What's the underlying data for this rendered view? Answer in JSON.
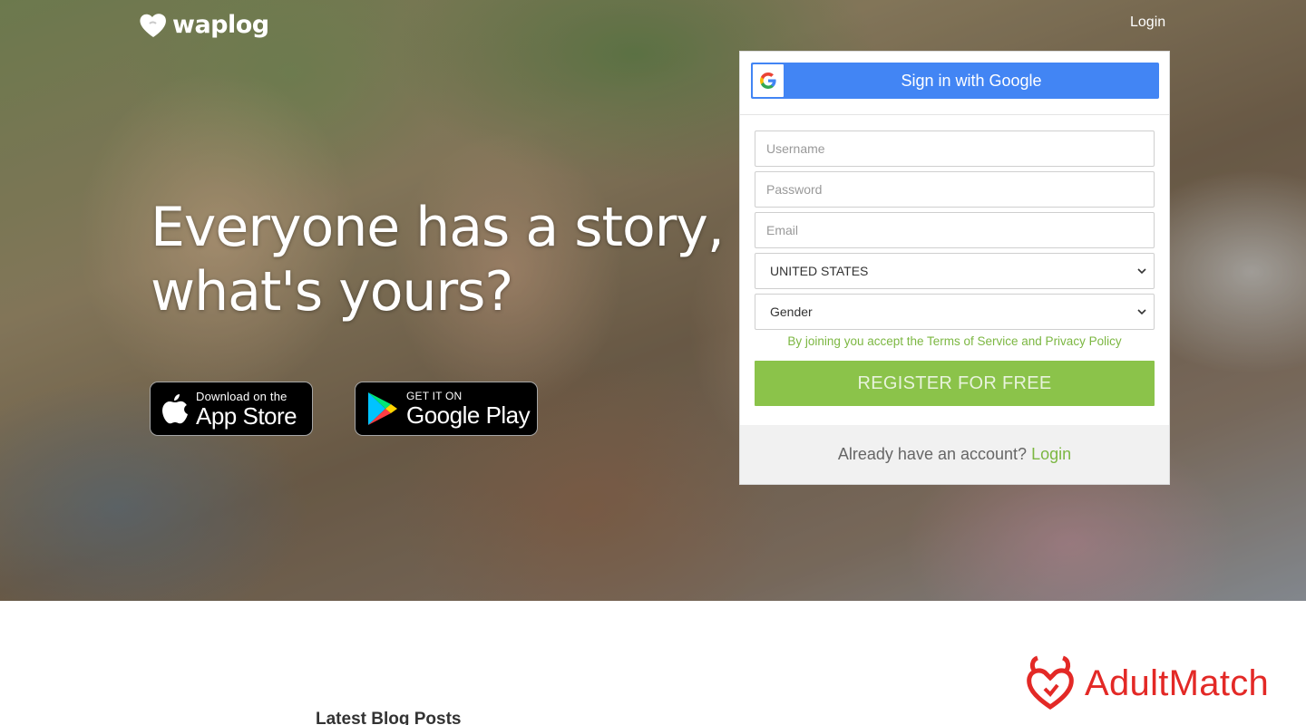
{
  "header": {
    "logo_text": "waplog",
    "login_link": "Login"
  },
  "hero": {
    "headline_line1": "Everyone has a story,",
    "headline_line2": "what's yours?"
  },
  "app_store": {
    "small": "Download on the",
    "big": "App Store"
  },
  "google_play": {
    "small": "GET IT ON",
    "big": "Google Play"
  },
  "register": {
    "google_button": "Sign in with Google",
    "username_placeholder": "Username",
    "password_placeholder": "Password",
    "email_placeholder": "Email",
    "country_value": "UNITED STATES",
    "gender_value": "Gender",
    "terms_text": "By joining you accept the Terms of Service and Privacy Policy",
    "register_button": "REGISTER FOR FREE",
    "already_text": "Already have an account?",
    "login_link": "Login"
  },
  "blog": {
    "title": "Latest Blog Posts"
  },
  "ad": {
    "brand": "AdultMatch"
  },
  "colors": {
    "accent_green": "#8bc34a",
    "google_blue": "#4285f4",
    "brand_red": "#e32926"
  }
}
